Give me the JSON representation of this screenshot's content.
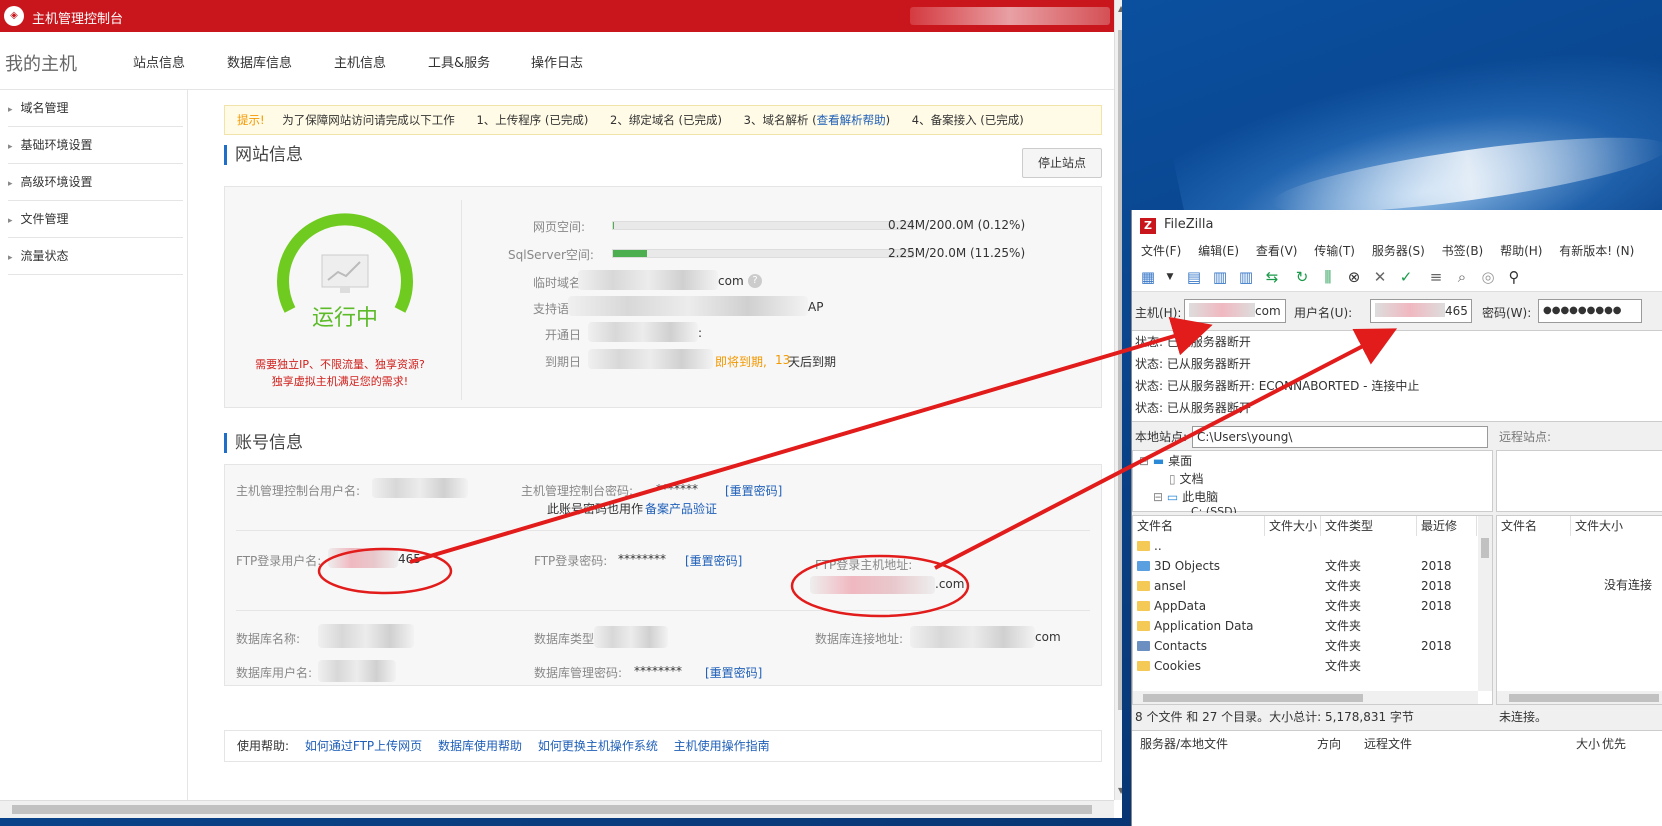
{
  "browser": {
    "title": "主机管理控制台",
    "brand": "我的主机",
    "nav": [
      "站点信息",
      "数据库信息",
      "主机信息",
      "工具&服务",
      "操作日志"
    ],
    "sidebar": [
      "域名管理",
      "基础环境设置",
      "高级环境设置",
      "文件管理",
      "流量状态"
    ],
    "tip": {
      "label": "提示!",
      "text": "为了保障网站访问请完成以下工作",
      "step1": "1、上传程序 (已完成)",
      "step2": "2、绑定域名 (已完成)",
      "step3_prefix": "3、域名解析 (",
      "step3_link": "查看解析帮助",
      "step3_suffix": ")",
      "step4": "4、备案接入 (已完成)"
    },
    "site": {
      "section_title": "网站信息",
      "stop_button": "停止站点",
      "state": "运行中",
      "promo_line1": "需要独立IP、不限流量、独享资源?",
      "promo_line2": "独享虚拟主机满足您的需求!",
      "web_space_label": "网页空间:",
      "web_space_value": "0.24M/200.0M (0.12%)",
      "web_space_percent": 0.12,
      "sql_label": "SqlServer空间:",
      "sql_value": "2.25M/20.0M (11.25%)",
      "sql_percent": 11.25,
      "temp_domain_label": "临时域名",
      "temp_domain_suffix": "com",
      "support_label": "支持语",
      "support_suffix": "AP",
      "open_label": "开通日",
      "open_suffix": ":",
      "expire_label": "到期日",
      "expire_warn": "即将到期,",
      "expire_days": "13",
      "expire_tail": "天后到期"
    },
    "account": {
      "section_title": "账号信息",
      "ctrl_user_label": "主机管理控制台用户名:",
      "ctrl_pass_label": "主机管理控制台密码:",
      "ctrl_pass_value": "*******",
      "reset": "[重置密码]",
      "ctrl_note": "此账号密码也用作",
      "ctrl_note_link": "备案产品验证",
      "ftp_user_label": "FTP登录用户名:",
      "ftp_user_suffix": "465",
      "ftp_pass_label": "FTP登录密码:",
      "ftp_pass_value": "********",
      "ftp_host_label": "FTP登录主机地址:",
      "ftp_host_suffix": ".com",
      "db_name_label": "数据库名称:",
      "db_type_label": "数据库类型",
      "db_conn_label": "数据库连接地址:",
      "db_conn_suffix": "com",
      "db_user_label": "数据库用户名:",
      "db_pass_label": "数据库管理密码:",
      "db_pass_value": "********"
    },
    "help": {
      "label": "使用帮助:",
      "links": [
        "如何通过FTP上传网页",
        "数据库使用帮助",
        "如何更换主机操作系统",
        "主机使用操作指南"
      ]
    }
  },
  "filezilla": {
    "title": "FileZilla",
    "menu": [
      "文件(F)",
      "编辑(E)",
      "查看(V)",
      "传输(T)",
      "服务器(S)",
      "书签(B)",
      "帮助(H)",
      "有新版本! (N)"
    ],
    "host_label": "主机(H):",
    "host_value": "com",
    "user_label": "用户名(U):",
    "user_value": "465",
    "pass_label": "密码(W):",
    "pass_value": "●●●●●●●●●",
    "log": [
      "状态: 已从服务器断开",
      "状态: 已从服务器断开",
      "状态: 已从服务器断开: ECONNABORTED - 连接中止",
      "状态: 已从服务器断开"
    ],
    "local_site_label": "本地站点:",
    "local_site_path": "C:\\Users\\young\\",
    "remote_site_label": "远程站点:",
    "tree": [
      "桌面",
      "文档",
      "此电脑",
      "C: (SSD)"
    ],
    "file_headers": [
      "文件名",
      "文件大小",
      "文件类型",
      "最近修"
    ],
    "files": [
      {
        "name": "..",
        "type": "",
        "date": ""
      },
      {
        "name": "3D Objects",
        "type": "文件夹",
        "date": "2018"
      },
      {
        "name": "ansel",
        "type": "文件夹",
        "date": "2018"
      },
      {
        "name": "AppData",
        "type": "文件夹",
        "date": "2018"
      },
      {
        "name": "Application Data",
        "type": "文件夹",
        "date": ""
      },
      {
        "name": "Contacts",
        "type": "文件夹",
        "date": "2018"
      },
      {
        "name": "Cookies",
        "type": "文件夹",
        "date": ""
      }
    ],
    "remote_headers": [
      "文件名",
      "文件大小"
    ],
    "remote_empty": "没有连接",
    "local_status": "8 个文件 和 27 个目录。大小总计: 5,178,831 字节",
    "remote_status": "未连接。",
    "queue_headers": [
      "服务器/本地文件",
      "方向",
      "远程文件",
      "大小",
      "优先"
    ]
  },
  "colors": {
    "brand_red": "#c9161c",
    "accent_green": "#5dbb2a",
    "link_blue": "#1f5fb8",
    "annotation_red": "#e21b1b"
  }
}
